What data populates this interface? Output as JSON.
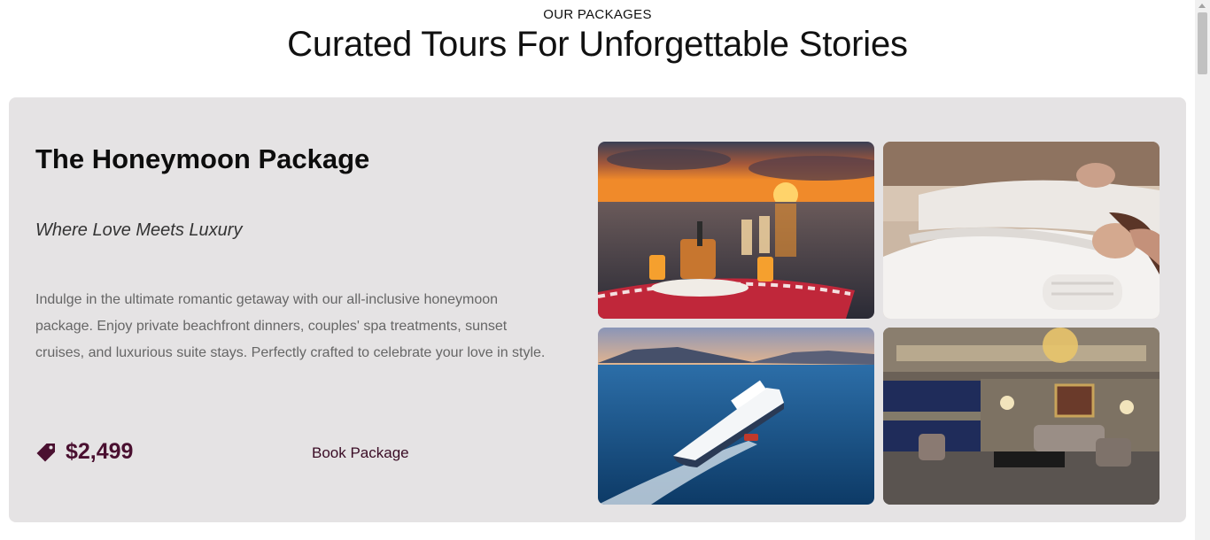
{
  "section": {
    "eyebrow": "OUR PACKAGES",
    "heading": "Curated Tours For Unforgettable Stories"
  },
  "package": {
    "title": "The Honeymoon Package",
    "subtitle": "Where Love Meets Luxury",
    "description": "Indulge in the ultimate romantic getaway with our all-inclusive honeymoon package. Enjoy private beachfront dinners, couples' spa treatments, sunset cruises, and luxurious suite stays. Perfectly crafted to celebrate your love in style.",
    "price": "$2,499",
    "price_icon": "price-tag-icon",
    "book_label": "Book Package",
    "images": [
      {
        "name": "beach-sunset-dinner-photo"
      },
      {
        "name": "couples-spa-photo"
      },
      {
        "name": "cruise-ship-photo"
      },
      {
        "name": "luxury-suite-photo"
      }
    ]
  },
  "colors": {
    "card_bg": "#e5e3e4",
    "accent": "#4a1030",
    "text_muted": "#666666"
  }
}
